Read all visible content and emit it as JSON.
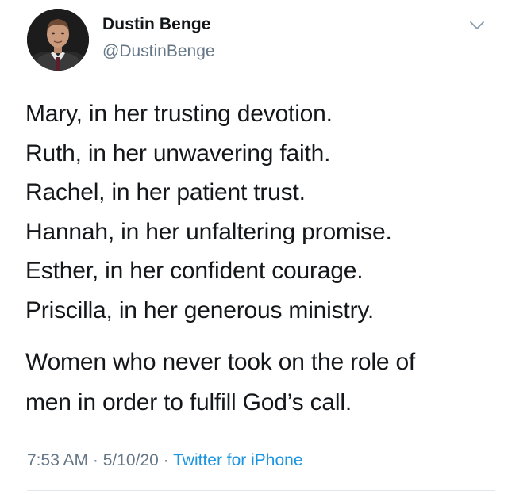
{
  "author": {
    "display_name": "Dustin Benge",
    "handle": "@DustinBenge"
  },
  "tweet": {
    "lines": [
      "Mary, in her trusting devotion.",
      "Ruth, in her unwavering faith.",
      "Rachel, in her patient trust.",
      "Hannah, in her unfaltering promise.",
      "Esther, in her confident courage.",
      "Priscilla, in her generous ministry."
    ],
    "closing_lines": [
      "Women who never took on the role of",
      "men in order to fulfill God’s call."
    ]
  },
  "meta": {
    "time": "7:53 AM",
    "sep1": " · ",
    "date": "5/10/20",
    "sep2": " · ",
    "source": "Twitter for iPhone"
  },
  "icons": {
    "menu": "chevron-down-icon",
    "avatar": "avatar"
  },
  "colors": {
    "text": "#14171a",
    "secondary": "#657786",
    "link": "#1b95e0"
  }
}
